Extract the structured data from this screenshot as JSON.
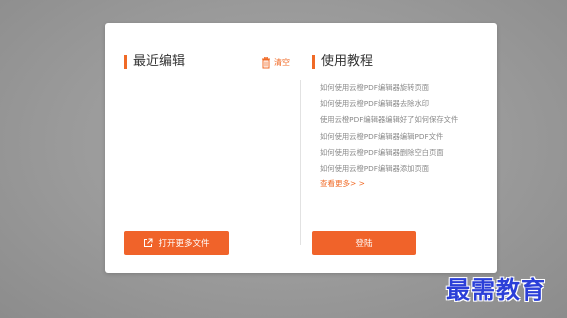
{
  "recent": {
    "title": "最近编辑",
    "clear_label": "清空",
    "open_more_label": "打开更多文件"
  },
  "tutorial": {
    "title": "使用教程",
    "items": [
      "如何使用云橙PDF编辑器旋转页面",
      "如何使用云橙PDF编辑器去除水印",
      "使用云橙PDF编辑器编辑好了如何保存文件",
      "如何使用云橙PDF编辑器编辑PDF文件",
      "如何使用云橙PDF编辑器删除空白页面",
      "如何使用云橙PDF编辑器添加页面"
    ],
    "more_label": "查看更多> >",
    "login_label": "登陆"
  },
  "watermark": {
    "text": "最需教育"
  },
  "colors": {
    "accent": "#f06a26",
    "button": "#f0632a",
    "watermark": "#2b3fd8"
  }
}
